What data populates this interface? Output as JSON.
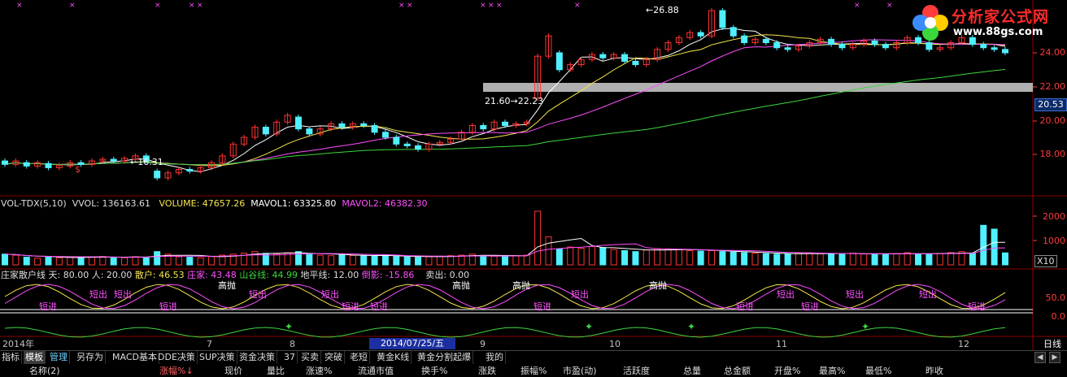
{
  "colors": {
    "up": "#ff3333",
    "down": "#4ff0ff",
    "ma5": "#ffffff",
    "ma10": "#f5e64a",
    "ma20": "#ff4fff",
    "ma60": "#3dd63d",
    "grid": "#8b0000",
    "axis": "#ff3b3b"
  },
  "logo": {
    "title": "分析家公式网",
    "url": "www.88gs.com",
    "icon": "flower-icon"
  },
  "price_panel": {
    "annotations": {
      "low1": "16.31",
      "high": "26.88",
      "range_low": "21.60",
      "range_high": "22.23"
    },
    "current_price": "20.53",
    "y_ticks": [
      "24.00",
      "22.00",
      "20.00",
      "18.00"
    ],
    "marker_dollar": "$"
  },
  "vol_panel": {
    "name": "VOL-TDX(5,10)",
    "vvol": "VVOL: 136163.61",
    "volume": "VOLUME: 47657.26",
    "mavol1": "MAVOL1: 63325.80",
    "mavol2": "MAVOL2: 46382.30",
    "y_ticks": [
      "2000",
      "1000"
    ],
    "unit": "X10"
  },
  "ind_panel": {
    "name": "庄家散户线",
    "tian": "天: 80.00",
    "ren": "人: 20.00",
    "sanhu": "散户: 46.53",
    "zhuangjia": "庄家: 43.48",
    "shangu": "山谷线: 44.99",
    "dipingxian": "地平线: 12.00",
    "daoying": "倒影: -15.86",
    "maichu": "卖出: 0.00",
    "y_ticks": [
      "50.0",
      "0.0"
    ],
    "signals": [
      {
        "text": "短出",
        "x": 110,
        "y": 362,
        "c": "#ff4fff"
      },
      {
        "text": "短出",
        "x": 140,
        "y": 362,
        "c": "#ff4fff"
      },
      {
        "text": "短进",
        "x": 48,
        "y": 377,
        "c": "#ff4fff"
      },
      {
        "text": "短进",
        "x": 196,
        "y": 377,
        "c": "#ff4fff"
      },
      {
        "text": "高抛",
        "x": 268,
        "y": 351,
        "c": "#ffffff"
      },
      {
        "text": "短出",
        "x": 306,
        "y": 362,
        "c": "#ff4fff"
      },
      {
        "text": "短出",
        "x": 395,
        "y": 362,
        "c": "#ff4fff"
      },
      {
        "text": "短进",
        "x": 420,
        "y": 377,
        "c": "#ff4fff"
      },
      {
        "text": "短进",
        "x": 455,
        "y": 377,
        "c": "#ff4fff"
      },
      {
        "text": "高抛",
        "x": 556,
        "y": 351,
        "c": "#ffffff"
      },
      {
        "text": "高抛",
        "x": 630,
        "y": 351,
        "c": "#ffffff"
      },
      {
        "text": "短进",
        "x": 656,
        "y": 377,
        "c": "#ff4fff"
      },
      {
        "text": "短出",
        "x": 702,
        "y": 362,
        "c": "#ff4fff"
      },
      {
        "text": "高抛",
        "x": 798,
        "y": 351,
        "c": "#ffffff"
      },
      {
        "text": "短出",
        "x": 955,
        "y": 362,
        "c": "#ff4fff"
      },
      {
        "text": "短进",
        "x": 905,
        "y": 377,
        "c": "#ff4fff"
      },
      {
        "text": "短进",
        "x": 985,
        "y": 377,
        "c": "#ff4fff"
      },
      {
        "text": "短出",
        "x": 1040,
        "y": 362,
        "c": "#ff4fff"
      },
      {
        "text": "短出",
        "x": 1130,
        "y": 362,
        "c": "#ff4fff"
      },
      {
        "text": "短进",
        "x": 1190,
        "y": 377,
        "c": "#ff4fff"
      }
    ]
  },
  "time_axis": {
    "labels": [
      "2014年",
      "7",
      "8",
      "9",
      "10",
      "11",
      "12"
    ],
    "selected_date": "2014/07/25/五",
    "period": "日线"
  },
  "tabs": [
    "指标",
    "模板",
    "管理",
    "另存为",
    "MACD基本",
    "DDE决策",
    "SUP决策",
    "资金决策",
    "37",
    "买卖",
    "突破",
    "老短",
    "黄金K线",
    "黄金分割起爆",
    "我的"
  ],
  "active_tab": "模板",
  "columns": [
    "名称(2)",
    "涨幅%↓",
    "现价",
    "量比",
    "涨速%",
    "流通市值",
    "换手%",
    "涨跌",
    "振幅%",
    "市盈(动)",
    "活跃度",
    "总量",
    "总金额",
    "开盘%",
    "最高%",
    "最低%",
    "昨收"
  ],
  "chart_data": {
    "type": "candlestick",
    "series": [
      {
        "name": "K",
        "values": [
          [
            17.6,
            17.4
          ],
          [
            17.4,
            17.6
          ],
          [
            17.5,
            17.3
          ],
          [
            17.3,
            17.5
          ],
          [
            17.45,
            17.2
          ],
          [
            17.2,
            17.35
          ],
          [
            17.3,
            17.5
          ],
          [
            17.5,
            17.4
          ],
          [
            17.4,
            17.6
          ],
          [
            17.6,
            17.7
          ],
          [
            17.7,
            17.6
          ],
          [
            17.6,
            17.75
          ],
          [
            17.7,
            17.9
          ],
          [
            17.9,
            17.6
          ],
          [
            17.0,
            16.6
          ],
          [
            16.6,
            16.9
          ],
          [
            16.9,
            17.1
          ],
          [
            17.1,
            17.0
          ],
          [
            17.0,
            17.2
          ],
          [
            17.2,
            17.5
          ],
          [
            17.5,
            17.9
          ],
          [
            17.9,
            18.6
          ],
          [
            18.6,
            19.0
          ],
          [
            19.0,
            19.6
          ],
          [
            19.6,
            19.2
          ],
          [
            19.2,
            19.9
          ],
          [
            19.9,
            20.3
          ],
          [
            20.2,
            19.5
          ],
          [
            19.5,
            19.2
          ],
          [
            19.2,
            19.5
          ],
          [
            19.5,
            19.8
          ],
          [
            19.8,
            19.6
          ],
          [
            19.6,
            19.8
          ],
          [
            19.8,
            19.7
          ],
          [
            19.7,
            19.3
          ],
          [
            19.3,
            19.0
          ],
          [
            19.0,
            18.6
          ],
          [
            18.6,
            18.5
          ],
          [
            18.5,
            18.3
          ],
          [
            18.3,
            18.6
          ],
          [
            18.6,
            18.7
          ],
          [
            18.7,
            18.9
          ],
          [
            18.9,
            19.3
          ],
          [
            19.3,
            19.7
          ],
          [
            19.7,
            19.5
          ],
          [
            19.5,
            19.9
          ],
          [
            19.9,
            19.7
          ],
          [
            19.7,
            19.8
          ],
          [
            19.8,
            19.9
          ],
          [
            21.3,
            23.8
          ],
          [
            23.8,
            25.0
          ],
          [
            24.0,
            23.0
          ],
          [
            23.0,
            23.3
          ],
          [
            23.3,
            23.6
          ],
          [
            23.6,
            23.9
          ],
          [
            23.9,
            23.7
          ],
          [
            23.7,
            23.9
          ],
          [
            23.9,
            23.5
          ],
          [
            23.5,
            23.3
          ],
          [
            23.3,
            23.6
          ],
          [
            23.6,
            24.2
          ],
          [
            24.2,
            24.6
          ],
          [
            24.6,
            24.9
          ],
          [
            24.9,
            25.2
          ],
          [
            25.2,
            25.0
          ],
          [
            25.0,
            26.5
          ],
          [
            26.5,
            25.5
          ],
          [
            25.5,
            25.0
          ],
          [
            25.0,
            24.6
          ],
          [
            24.6,
            24.8
          ],
          [
            24.8,
            24.6
          ],
          [
            24.6,
            24.3
          ],
          [
            24.3,
            24.2
          ],
          [
            24.2,
            24.4
          ],
          [
            24.4,
            24.6
          ],
          [
            24.6,
            24.8
          ],
          [
            24.8,
            24.5
          ],
          [
            24.5,
            24.3
          ],
          [
            24.3,
            24.5
          ],
          [
            24.5,
            24.7
          ],
          [
            24.7,
            24.5
          ],
          [
            24.5,
            24.3
          ],
          [
            24.3,
            24.6
          ],
          [
            24.6,
            24.9
          ],
          [
            24.9,
            24.6
          ],
          [
            24.6,
            24.2
          ],
          [
            24.2,
            24.3
          ],
          [
            24.3,
            24.6
          ],
          [
            24.6,
            24.9
          ],
          [
            24.9,
            24.5
          ],
          [
            24.5,
            24.3
          ],
          [
            24.3,
            24.2
          ],
          [
            24.2,
            24.0
          ]
        ]
      },
      {
        "name": "VOL",
        "values": [
          420,
          380,
          300,
          260,
          310,
          280,
          300,
          290,
          310,
          330,
          300,
          280,
          320,
          300,
          520,
          420,
          320,
          300,
          280,
          330,
          380,
          420,
          460,
          520,
          450,
          420,
          480,
          520,
          410,
          380,
          360,
          400,
          370,
          360,
          340,
          380,
          330,
          310,
          300,
          320,
          340,
          360,
          380,
          420,
          360,
          340,
          330,
          360,
          380,
          2100,
          1100,
          620,
          700,
          650,
          720,
          680,
          600,
          560,
          520,
          580,
          640,
          620,
          600,
          560,
          540,
          560,
          520,
          500,
          480,
          460,
          440,
          420,
          430,
          450,
          470,
          440,
          420,
          440,
          460,
          430,
          420,
          410,
          440,
          480,
          430,
          420,
          450,
          480,
          520,
          460,
          1550,
          1400,
          470
        ]
      }
    ],
    "y_ticks": [
      24,
      22,
      20,
      18
    ]
  }
}
